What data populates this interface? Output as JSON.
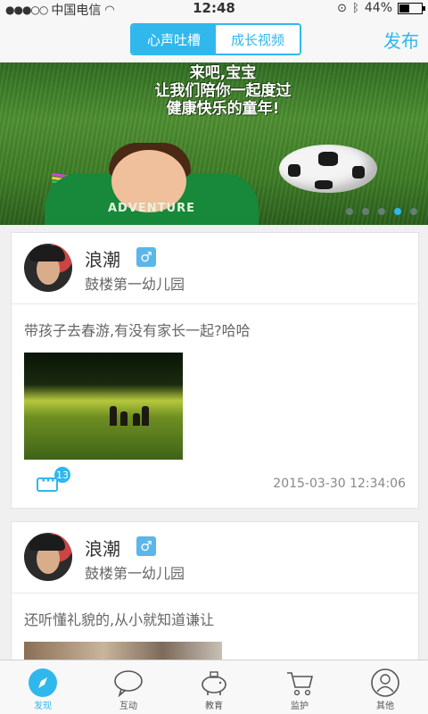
{
  "status": {
    "signal": "●●●○○",
    "carrier": "中国电信",
    "time": "12:48",
    "battery": "44%",
    "battery_level": 0.44
  },
  "nav": {
    "tabs": [
      {
        "label": "心声吐槽",
        "active": true
      },
      {
        "label": "成长视频",
        "active": false
      }
    ],
    "publish": "发布"
  },
  "banner": {
    "caption_line1": "来吧,宝宝",
    "caption_line2": "让我们陪你一起度过",
    "caption_line3": "健康快乐的童年!",
    "shirt_text": "ADVENTURE",
    "pages": 5,
    "active_page": 4
  },
  "posts": [
    {
      "user": "浪潮",
      "gender": "♂",
      "school": "鼓楼第一幼儿园",
      "text": "带孩子去春游,有没有家长一起?哈哈",
      "comments": "13",
      "date": "2015-03-30 12:34:06"
    },
    {
      "user": "浪潮",
      "gender": "♂",
      "school": "鼓楼第一幼儿园",
      "text": "还听懂礼貌的,从小就知道谦让"
    }
  ],
  "tabbar": [
    {
      "label": "发现",
      "icon": "compass-icon",
      "active": true
    },
    {
      "label": "互动",
      "icon": "chat-bubble-icon",
      "active": false
    },
    {
      "label": "教育",
      "icon": "piggy-bank-icon",
      "active": false
    },
    {
      "label": "监护",
      "icon": "cart-icon",
      "active": false
    },
    {
      "label": "其他",
      "icon": "user-icon",
      "active": false
    }
  ],
  "colors": {
    "accent": "#30b8ec",
    "tab_active": "#30b8ec"
  }
}
